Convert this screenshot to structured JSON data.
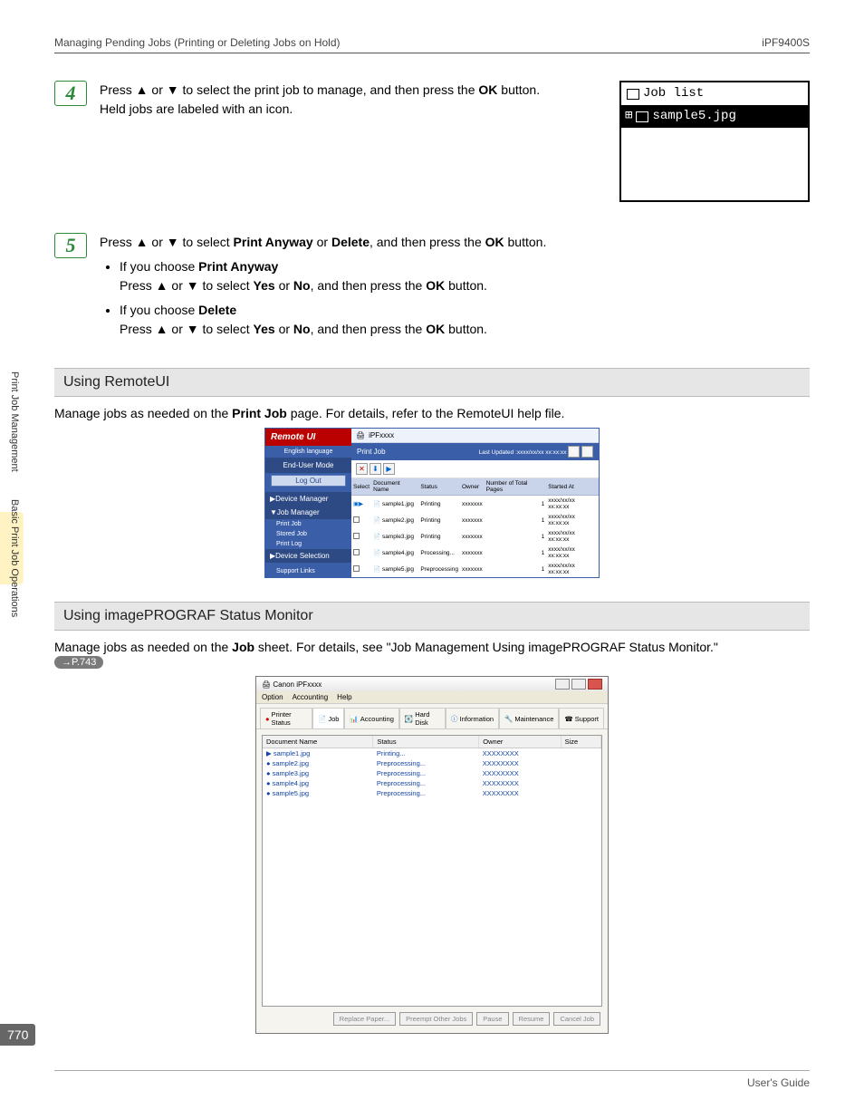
{
  "header": {
    "title": "Managing Pending Jobs (Printing or Deleting Jobs on Hold)",
    "model": "iPF9400S"
  },
  "sidebar": {
    "tab1": "Print Job Management",
    "tab2": "Basic Print Job Operations"
  },
  "pageNumber": "770",
  "footer": "User's Guide",
  "steps": {
    "s4": {
      "num": "4",
      "line1a": "Press ▲ or ▼ to select the print job to manage, and then press the ",
      "line1b": "OK",
      "line1c": " button.",
      "line2": "Held jobs are labeled with an icon."
    },
    "s5": {
      "num": "5",
      "main_a": "Press ▲ or ▼ to select ",
      "main_b": "Print Anyway",
      "main_c": " or ",
      "main_d": "Delete",
      "main_e": ", and then press the ",
      "main_f": "OK",
      "main_g": " button.",
      "b1_a": "If you choose ",
      "b1_b": "Print Anyway",
      "b1_line2a": "Press ▲ or ▼ to select ",
      "b1_line2b": "Yes",
      "b1_line2c": " or ",
      "b1_line2d": "No",
      "b1_line2e": ", and then press the ",
      "b1_line2f": "OK",
      "b1_line2g": " button.",
      "b2_a": "If you choose ",
      "b2_b": "Delete",
      "b2_line2a": "Press ▲ or ▼ to select ",
      "b2_line2b": "Yes",
      "b2_line2c": " or ",
      "b2_line2d": "No",
      "b2_line2e": ", and then press the ",
      "b2_line2f": "OK",
      "b2_line2g": " button."
    }
  },
  "lcd": {
    "title": "Job list",
    "item": "sample5.jpg"
  },
  "sections": {
    "remoteui_title": "Using RemoteUI",
    "remoteui_desc_a": "Manage jobs as needed on the ",
    "remoteui_desc_b": "Print Job",
    "remoteui_desc_c": " page. For details, refer to the RemoteUI help file.",
    "sm_title": "Using imagePROGRAF Status Monitor",
    "sm_desc_a": "Manage jobs as needed on the ",
    "sm_desc_b": "Job",
    "sm_desc_c": " sheet. For details, see \"Job Management Using imagePROGRAF Status Monitor.\"",
    "sm_ref": "→P.743"
  },
  "remoteui": {
    "brand": "Remote UI",
    "lang": "English language",
    "mode": "End-User Mode",
    "logout": "Log Out",
    "menu_dev": "▶Device Manager",
    "menu_job": "▼Job Manager",
    "menu_job_items": [
      "Print Job",
      "Stored Job",
      "Print Log"
    ],
    "menu_devsel": "▶Device Selection",
    "menu_support": "Support Links",
    "topbar": "iPFxxxx",
    "tab": "Print Job",
    "updated": "Last Updated :xxxx/xx/xx xx:xx:xx",
    "cols": [
      "Select",
      "Document Name",
      "Status",
      "Owner",
      "Number of Total Pages",
      "Started At"
    ],
    "rows": [
      {
        "doc": "sample1.jpg",
        "status": "Printing",
        "owner": "xxxxxxx",
        "pages": "1",
        "started": "xxxx/xx/xx xx:xx:xx"
      },
      {
        "doc": "sample2.jpg",
        "status": "Printing",
        "owner": "xxxxxxx",
        "pages": "1",
        "started": "xxxx/xx/xx xx:xx:xx"
      },
      {
        "doc": "sample3.jpg",
        "status": "Printing",
        "owner": "xxxxxxx",
        "pages": "1",
        "started": "xxxx/xx/xx xx:xx:xx"
      },
      {
        "doc": "sample4.jpg",
        "status": "Processing...",
        "owner": "xxxxxxx",
        "pages": "1",
        "started": "xxxx/xx/xx xx:xx:xx"
      },
      {
        "doc": "sample5.jpg",
        "status": "Preprocessing",
        "owner": "xxxxxxx",
        "pages": "1",
        "started": "xxxx/xx/xx xx:xx:xx"
      }
    ]
  },
  "sm": {
    "title": "Canon iPFxxxx",
    "menu": [
      "Option",
      "Accounting",
      "Help"
    ],
    "tabs": [
      "Printer Status",
      "Job",
      "Accounting",
      "Hard Disk",
      "Information",
      "Maintenance",
      "Support"
    ],
    "cols": [
      "Document Name",
      "Status",
      "Owner",
      "Size"
    ],
    "rows": [
      {
        "doc": "sample1.jpg",
        "status": "Printing...",
        "owner": "XXXXXXXX"
      },
      {
        "doc": "sample2.jpg",
        "status": "Preprocessing...",
        "owner": "XXXXXXXX"
      },
      {
        "doc": "sample3.jpg",
        "status": "Preprocessing...",
        "owner": "XXXXXXXX"
      },
      {
        "doc": "sample4.jpg",
        "status": "Preprocessing...",
        "owner": "XXXXXXXX"
      },
      {
        "doc": "sample5.jpg",
        "status": "Preprocessing...",
        "owner": "XXXXXXXX"
      }
    ],
    "buttons": [
      "Replace Paper...",
      "Preempt Other Jobs",
      "Pause",
      "Resume",
      "Cancel Job"
    ]
  }
}
